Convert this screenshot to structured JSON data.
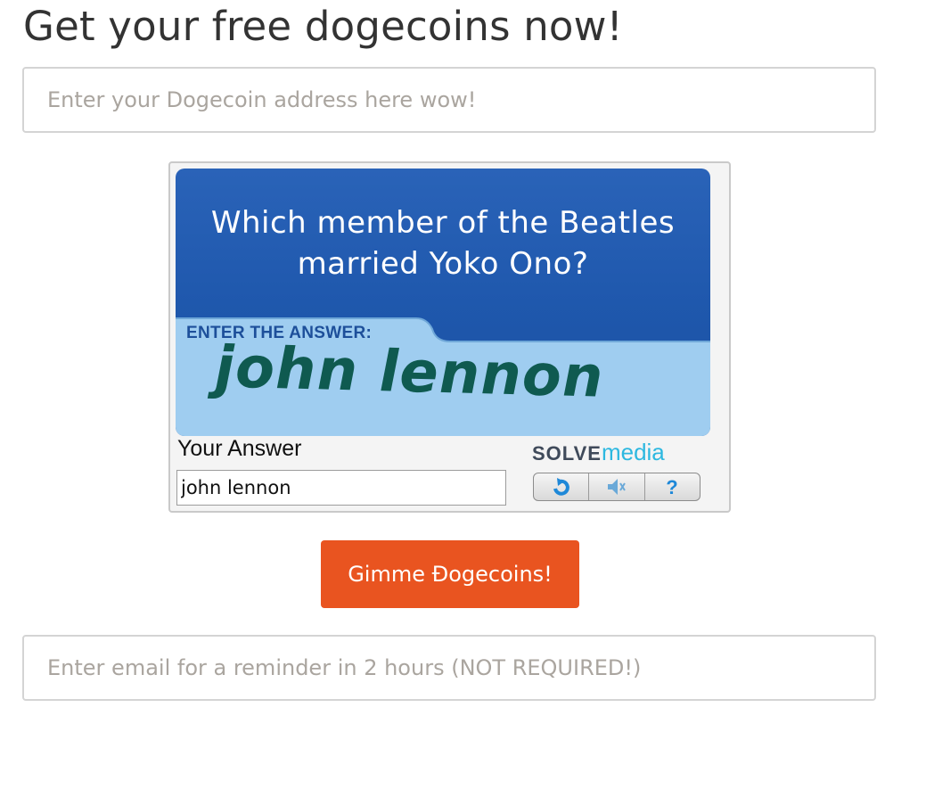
{
  "page": {
    "title": "Get your free dogecoins now!"
  },
  "address_input": {
    "placeholder": "Enter your Dogecoin address here wow!"
  },
  "captcha": {
    "question": "Which member of the Beatles married Yoko Ono?",
    "instruction": "ENTER THE ANSWER:",
    "answer_image_text": "john lennon",
    "your_answer_label": "Your Answer",
    "answer_value": "john lennon",
    "brand_part1": "SOLVE",
    "brand_part2": "media",
    "controls": [
      "refresh-icon",
      "audio-icon",
      "help-icon"
    ]
  },
  "submit": {
    "label": "Gimme Đogecoins!",
    "color": "#e95420"
  },
  "email_input": {
    "placeholder": "Enter email for a reminder in 2 hours (NOT REQUIRED!)"
  }
}
